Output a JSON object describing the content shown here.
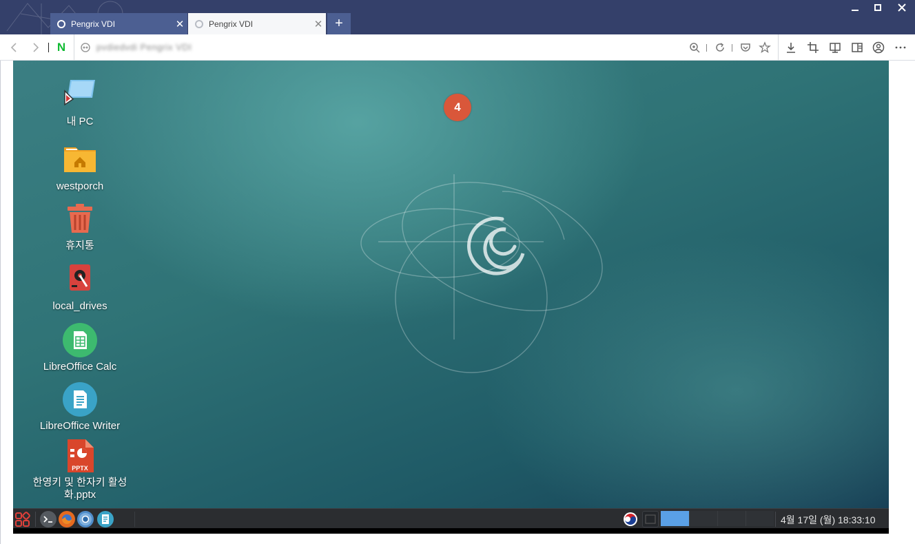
{
  "browser": {
    "tabs": [
      {
        "label": "Pengrix VDI",
        "active": true
      },
      {
        "label": "Pengrix VDI",
        "active": false
      }
    ],
    "close_glyph": "✕",
    "newtab_glyph": "+",
    "window_controls": {
      "minimize": "—",
      "maximize": "☐",
      "close": "✕"
    },
    "address": "pvdiedvdi Pengrix VDI",
    "address_blurred": true,
    "nav_logo": "N",
    "toolbar_icons": [
      "back-icon",
      "forward-icon",
      "zoom-icon",
      "reload-icon",
      "pocket-icon",
      "star-icon",
      "download-icon",
      "crop-icon",
      "reader-icon",
      "sidebar-icon",
      "account-icon",
      "more-icon"
    ],
    "colors": {
      "titlebar": "#34406a",
      "active_tab": "#4c5f92"
    }
  },
  "desktop": {
    "notification_badge": "4",
    "icons": [
      {
        "label": "내 PC"
      },
      {
        "label": "westporch"
      },
      {
        "label": "휴지통"
      },
      {
        "label": "local_drives"
      },
      {
        "label": "LibreOffice Calc"
      },
      {
        "label": "LibreOffice Writer"
      },
      {
        "label": "한영키 및 한자키 활성화.pptx",
        "badge": "PPTX"
      }
    ]
  },
  "taskbar": {
    "clock": "4월 17일 (월) 18:33:10"
  }
}
